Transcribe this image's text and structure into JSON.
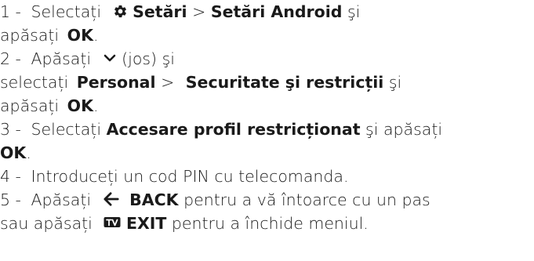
{
  "steps": [
    {
      "num": "1 -",
      "t1": "Selectați",
      "settings_icon": "gear-icon",
      "settings": "Setări",
      "sep": ">",
      "android_settings": "Setări Android",
      "t2": "şi",
      "t3": "apăsați",
      "ok": "OK",
      "t4": "."
    },
    {
      "num": "2 -",
      "t1": "Apăsați",
      "down_icon": "chevron-down-icon",
      "t2": "(jos) şi",
      "t3": "selectați",
      "personal": "Personal",
      "sep": ">",
      "security": "Securitate şi restricții",
      "t4": "şi",
      "t5": "apăsați",
      "ok": "OK",
      "t6": "."
    },
    {
      "num": "3 -",
      "t1": "Selectați",
      "profile": "Accesare profil restricționat",
      "t2": "şi apăsați",
      "ok": "OK",
      "t3": "."
    },
    {
      "num": "4 -",
      "t1": "Introduceți un cod PIN cu telecomanda."
    },
    {
      "num": "5 -",
      "t1": "Apăsați",
      "back_icon": "arrow-left-icon",
      "back": "BACK",
      "t2": "pentru a vă întoarce cu un pas",
      "t3": "sau apăsați",
      "tv_icon": "tv-icon",
      "exit": "EXIT",
      "t4": "pentru a închide meniul."
    }
  ]
}
